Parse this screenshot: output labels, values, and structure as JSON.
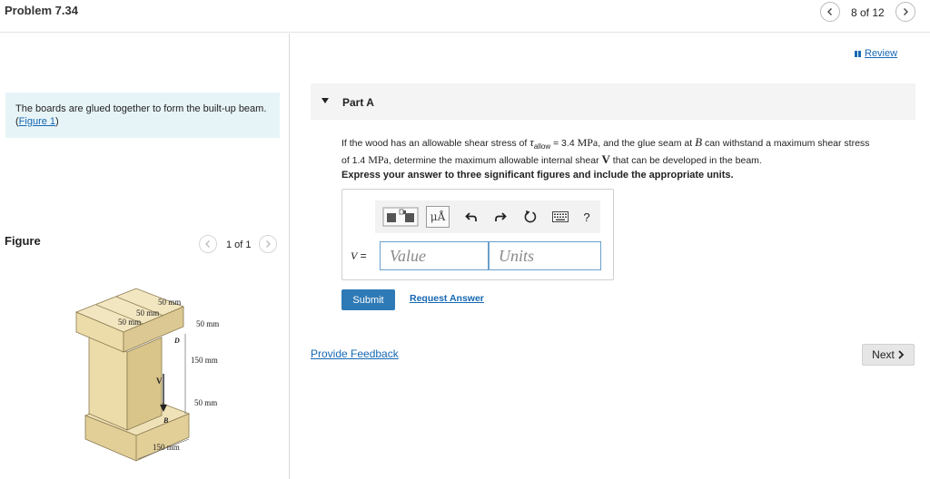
{
  "header": {
    "problem_title": "Problem 7.34",
    "page_count": "8 of 12"
  },
  "intro": {
    "text": "The boards are glued together to form the built-up beam.",
    "figure_link_prefix": "(",
    "figure_link": "Figure 1",
    "figure_link_suffix": ")"
  },
  "figure_panel": {
    "label": "Figure",
    "count": "1 of 1",
    "dimensions": {
      "top_width_1": "50 mm",
      "top_width_2": "50 mm",
      "top_width_3": "50 mm",
      "flange_thickness": "50 mm",
      "web_height": "150 mm",
      "bottom_flange_thickness": "50 mm",
      "bottom_width": "150 mm"
    },
    "labels": {
      "point_d": "D",
      "point_b": "B",
      "shear": "V"
    }
  },
  "review": {
    "label": "Review"
  },
  "part": {
    "title": "Part A",
    "question_line1_a": "If the wood has an allowable shear stress of ",
    "tau_symbol": "τ",
    "tau_sub": "allow",
    "question_line1_b": " = 3.4 ",
    "unit_mpa_1": "MPa",
    "question_line1_c": ", and the glue seam at ",
    "point_b": "B",
    "question_line1_d": " can withstand a maximum shear stress",
    "question_line2_a": "of 1.4 ",
    "unit_mpa_2": "MPa",
    "question_line2_b": ", determine the maximum allowable internal shear ",
    "shear_symbol": "V",
    "question_line2_c": " that can be developed in the beam.",
    "instruction": "Express your answer to three significant figures and include the appropriate units."
  },
  "answer": {
    "variable": "V",
    "equals": " =",
    "value_placeholder": "Value",
    "units_placeholder": "Units",
    "toolbar": {
      "mu_label": "μÅ",
      "help_label": "?"
    }
  },
  "actions": {
    "submit": "Submit",
    "request_answer": "Request Answer",
    "provide_feedback": "Provide Feedback",
    "next": "Next"
  },
  "colors": {
    "link": "#1668b3",
    "submit_bg": "#2e7ab6",
    "intro_bg": "#e7f4f7",
    "input_border": "#6aa0cb",
    "wood": "#ecdcaa"
  },
  "icons": [
    "chevron-left-icon",
    "chevron-right-icon",
    "review-icon",
    "caret-down-icon",
    "template-icon",
    "undo-icon",
    "redo-icon",
    "reset-icon",
    "keyboard-icon",
    "help-icon"
  ]
}
